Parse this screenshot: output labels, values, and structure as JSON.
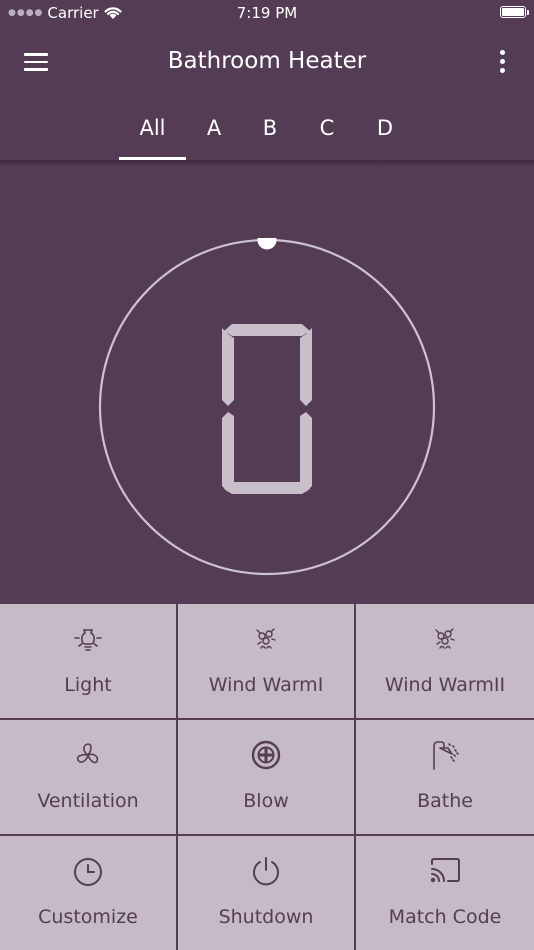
{
  "status": {
    "carrier": "Carrier",
    "time": "7:19 PM"
  },
  "header": {
    "title": "Bathroom Heater"
  },
  "tabs": [
    {
      "label": "All",
      "selected": true
    },
    {
      "label": "A",
      "selected": false
    },
    {
      "label": "B",
      "selected": false
    },
    {
      "label": "C",
      "selected": false
    },
    {
      "label": "D",
      "selected": false
    }
  ],
  "display": {
    "digit": "0"
  },
  "controls": [
    {
      "label": "Light",
      "icon": "bulb-icon"
    },
    {
      "label": "Wind WarmI",
      "icon": "warm-wind-icon"
    },
    {
      "label": "Wind WarmII",
      "icon": "warm-wind-icon"
    },
    {
      "label": "Ventilation",
      "icon": "fan-icon"
    },
    {
      "label": "Blow",
      "icon": "blow-icon"
    },
    {
      "label": "Bathe",
      "icon": "shower-icon"
    },
    {
      "label": "Customize",
      "icon": "clock-icon"
    },
    {
      "label": "Shutdown",
      "icon": "power-icon"
    },
    {
      "label": "Match Code",
      "icon": "cast-icon"
    }
  ],
  "colors": {
    "background": "#533c54",
    "button": "#c5bac6",
    "button_text": "#553d56"
  }
}
